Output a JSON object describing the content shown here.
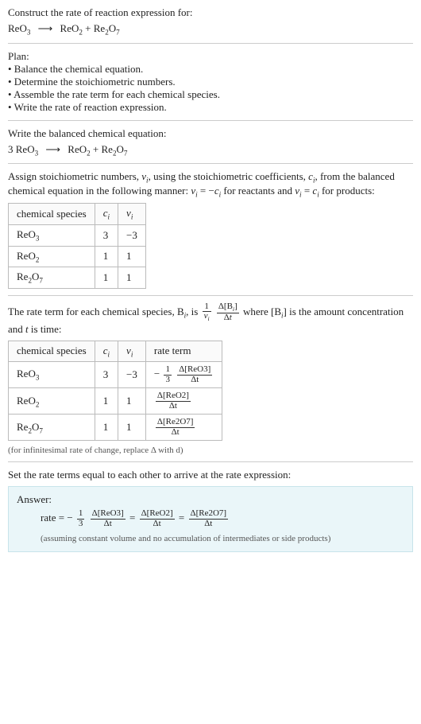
{
  "header": {
    "prompt": "Construct the rate of reaction expression for:"
  },
  "equation": {
    "reactant1": "ReO",
    "reactant1_sub": "3",
    "arrow": "⟶",
    "product1": "ReO",
    "product1_sub": "2",
    "plus": " + ",
    "product2": "Re",
    "product2_sub1": "2",
    "product2_mid": "O",
    "product2_sub2": "7"
  },
  "plan": {
    "title": "Plan:",
    "b1": "• Balance the chemical equation.",
    "b2": "• Determine the stoichiometric numbers.",
    "b3": "• Assemble the rate term for each chemical species.",
    "b4": "• Write the rate of reaction expression."
  },
  "balanced": {
    "title": "Write the balanced chemical equation:",
    "coef": "3 "
  },
  "assign": {
    "line1a": "Assign stoichiometric numbers, ",
    "nu": "ν",
    "i": "i",
    "line1b": ", using the stoichiometric coefficients, ",
    "c": "c",
    "line1c": ", from the balanced chemical equation in the following manner: ",
    "eq1": " = −",
    "line1d": " for reactants and ",
    "eq2": " = ",
    "line1e": " for products:"
  },
  "table1": {
    "h1": "chemical species",
    "h2": "c",
    "h2i": "i",
    "h3": "ν",
    "h3i": "i",
    "rows": [
      {
        "sp": "ReO",
        "sub": "3",
        "c": "3",
        "nu": "−3"
      },
      {
        "sp": "ReO",
        "sub": "2",
        "c": "1",
        "nu": "1"
      },
      {
        "sp": "Re",
        "sub": "",
        "sp2": "O",
        "sub2": "7",
        "pre2": "2",
        "c": "1",
        "nu": "1"
      }
    ]
  },
  "rateterm": {
    "a": "The rate term for each chemical species, B",
    "b": ", is ",
    "c": " where [B",
    "d": "] is the amount concentration and ",
    "t": "t",
    "e": " is time:"
  },
  "table2": {
    "h1": "chemical species",
    "h2": "c",
    "h3": "ν",
    "h4": "rate term",
    "rows": [
      {
        "sp": "ReO",
        "sub": "3",
        "c": "3",
        "nu": "−3",
        "neg": "−",
        "fnum": "1",
        "fden": "3",
        "dnum": "Δ[ReO3]",
        "dden": "Δt"
      },
      {
        "sp": "ReO",
        "sub": "2",
        "c": "1",
        "nu": "1",
        "dnum": "Δ[ReO2]",
        "dden": "Δt"
      },
      {
        "sp": "Re2O7",
        "c": "1",
        "nu": "1",
        "dnum": "Δ[Re2O7]",
        "dden": "Δt"
      }
    ]
  },
  "inf_note": "(for infinitesimal rate of change, replace Δ with d)",
  "final": {
    "title": "Set the rate terms equal to each other to arrive at the rate expression:",
    "answer_label": "Answer:",
    "rate": "rate = ",
    "neg": "−",
    "f1num": "1",
    "f1den": "3",
    "d1num": "Δ[ReO3]",
    "d1den": "Δt",
    "eq": " = ",
    "d2num": "Δ[ReO2]",
    "d2den": "Δt",
    "d3num": "Δ[Re2O7]",
    "d3den": "Δt",
    "assume": "(assuming constant volume and no accumulation of intermediates or side products)"
  }
}
